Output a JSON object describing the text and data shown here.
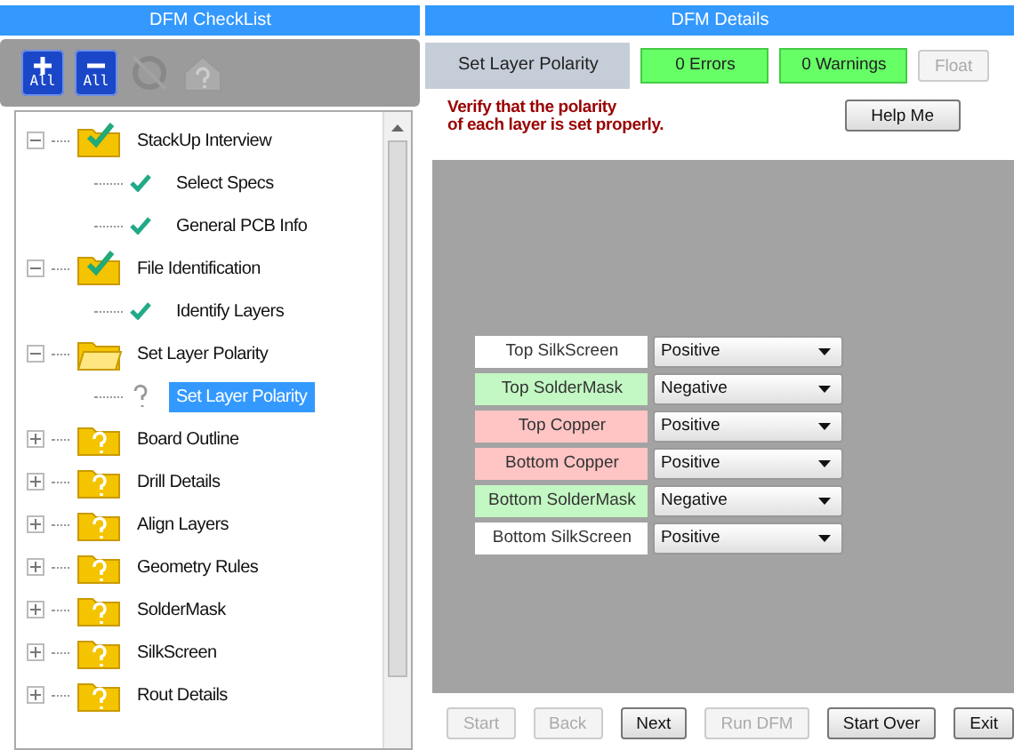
{
  "checklist": {
    "title": "DFM CheckList",
    "toolbar": [
      {
        "kind": "expand",
        "label": "All",
        "disabled": false
      },
      {
        "kind": "collapse",
        "label": "All",
        "disabled": false
      },
      {
        "kind": "refresh",
        "disabled": true
      },
      {
        "kind": "help",
        "disabled": true
      }
    ],
    "tree": [
      {
        "label": "StackUp Interview",
        "kind": "done",
        "expanded": true,
        "children": [
          {
            "label": "Select Specs",
            "checked": true,
            "selected": false
          },
          {
            "label": "General PCB Info",
            "checked": true,
            "selected": false
          }
        ]
      },
      {
        "label": "File Identification",
        "kind": "done",
        "expanded": true,
        "children": [
          {
            "label": "Identify Layers",
            "checked": true,
            "selected": false
          }
        ]
      },
      {
        "label": "Set Layer Polarity",
        "kind": "open",
        "expanded": true,
        "children": [
          {
            "label": "Set Layer Polarity",
            "checked": false,
            "selected": true
          }
        ]
      },
      {
        "label": "Board Outline",
        "kind": "pending",
        "expanded": false
      },
      {
        "label": "Drill Details",
        "kind": "pending",
        "expanded": false
      },
      {
        "label": "Align Layers",
        "kind": "pending",
        "expanded": false
      },
      {
        "label": "Geometry Rules",
        "kind": "pending",
        "expanded": false
      },
      {
        "label": "SolderMask",
        "kind": "pending",
        "expanded": false
      },
      {
        "label": "SilkScreen",
        "kind": "pending",
        "expanded": false
      },
      {
        "label": "Rout Details",
        "kind": "pending",
        "expanded": false
      }
    ]
  },
  "details": {
    "title": "DFM Details",
    "step": "Set Layer Polarity",
    "errors": "0 Errors",
    "warnings": "0 Warnings",
    "float": {
      "label": "Float",
      "disabled": true
    },
    "instruction": "Verify that the polarity\nof each layer is set properly.",
    "help": "Help Me",
    "layers": [
      {
        "name": "Top SilkScreen",
        "color": "#ffffff",
        "value": "Positive"
      },
      {
        "name": "Top SolderMask",
        "color": "#c3f7c3",
        "value": "Negative"
      },
      {
        "name": "Top Copper",
        "color": "#ffc4c4",
        "value": "Positive"
      },
      {
        "name": "Bottom Copper",
        "color": "#ffc4c4",
        "value": "Positive"
      },
      {
        "name": "Bottom SolderMask",
        "color": "#c3f7c3",
        "value": "Negative"
      },
      {
        "name": "Bottom SilkScreen",
        "color": "#ffffff",
        "value": "Positive"
      }
    ],
    "buttons": [
      {
        "label": "Start",
        "disabled": true
      },
      {
        "label": "Back",
        "disabled": true
      },
      {
        "label": "Next",
        "disabled": false
      },
      {
        "label": "Run DFM",
        "disabled": true
      },
      {
        "label": "Start Over",
        "disabled": false
      },
      {
        "label": "Exit",
        "disabled": false
      }
    ]
  }
}
